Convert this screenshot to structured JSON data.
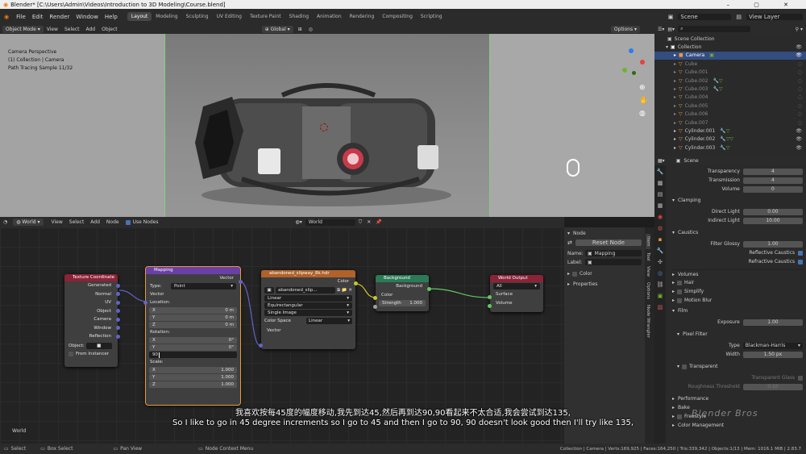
{
  "window": {
    "title": "Blender* [C:\\Users\\Admin\\Videos\\Introduction to 3D Modeling\\Course.blend]"
  },
  "menu": [
    "File",
    "Edit",
    "Render",
    "Window",
    "Help"
  ],
  "workspaces": [
    "Layout",
    "Modeling",
    "Sculpting",
    "UV Editing",
    "Texture Paint",
    "Shading",
    "Animation",
    "Rendering",
    "Compositing",
    "Scripting"
  ],
  "scene_name": "Scene",
  "view_layer": "View Layer",
  "viewport": {
    "mode": "Object Mode",
    "menus": [
      "View",
      "Select",
      "Add",
      "Object"
    ],
    "transform": "Global",
    "options": "Options",
    "overlay_text": [
      "Camera Perspective",
      "(1) Collection | Camera",
      "Path Tracing Sample 11/32"
    ]
  },
  "node_editor": {
    "type": "World",
    "menus": [
      "View",
      "Select",
      "Add",
      "Node"
    ],
    "use_nodes": "Use Nodes",
    "world_name": "World",
    "corner_label": "World",
    "nodes": {
      "tex_coord": {
        "title": "Texture Coordinate",
        "outputs": [
          "Generated",
          "Normal",
          "UV",
          "Object",
          "Camera",
          "Window",
          "Reflection"
        ],
        "object_label": "Object:",
        "from_instancer": "From Instancer"
      },
      "mapping": {
        "title": "Mapping",
        "out": "Vector",
        "type_label": "Type:",
        "type_value": "Point",
        "vector": "Vector",
        "location": "Location:",
        "loc": [
          {
            "k": "X",
            "v": "0 m"
          },
          {
            "k": "Y",
            "v": "0 m"
          },
          {
            "k": "Z",
            "v": "0 m"
          }
        ],
        "rotation": "Rotation:",
        "rot": [
          {
            "k": "X",
            "v": "0°"
          },
          {
            "k": "Y",
            "v": "0°"
          },
          {
            "k": "",
            "v": ""
          }
        ],
        "rot_edit": "90",
        "scale": "Scale:",
        "scl": [
          {
            "k": "X",
            "v": "1.000"
          },
          {
            "k": "Y",
            "v": "1.000"
          },
          {
            "k": "Z",
            "v": "1.000"
          }
        ]
      },
      "env": {
        "title": "abandoned_slipway_8k.hdr",
        "color": "Color",
        "file": "abandoned_slip...",
        "interp": "Linear",
        "proj": "Equirectangular",
        "source": "Single Image",
        "cs_label": "Color Space",
        "cs_value": "Linear",
        "vector": "Vector"
      },
      "background": {
        "title": "Background",
        "out": "Background",
        "color": "Color",
        "strength": "Strength",
        "strength_value": "1.000"
      },
      "world_output": {
        "title": "World Output",
        "target": "All",
        "surface": "Surface",
        "volume": "Volume"
      }
    }
  },
  "node_sidebar": {
    "section": "Node",
    "reset": "Reset Node",
    "name_label": "Name:",
    "name_value": "Mapping",
    "label_label": "Label:",
    "color": "Color",
    "properties": "Properties",
    "tabs": [
      "Item",
      "Tool",
      "View",
      "Options",
      "Node Wrangler"
    ]
  },
  "outliner": {
    "rows": [
      {
        "name": "Scene Collection",
        "indent": 0
      },
      {
        "name": "Collection",
        "indent": 1
      },
      {
        "name": "Camera",
        "indent": 2
      },
      {
        "name": "Cube",
        "indent": 2
      },
      {
        "name": "Cube.001",
        "indent": 2
      },
      {
        "name": "Cube.002",
        "indent": 2
      },
      {
        "name": "Cube.003",
        "indent": 2
      },
      {
        "name": "Cube.004",
        "indent": 2
      },
      {
        "name": "Cube.005",
        "indent": 2
      },
      {
        "name": "Cube.006",
        "indent": 2
      },
      {
        "name": "Cube.007",
        "indent": 2
      },
      {
        "name": "Cylinder.001",
        "indent": 2
      },
      {
        "name": "Cylinder.002",
        "indent": 2
      },
      {
        "name": "Cylinder.003",
        "indent": 2
      }
    ],
    "selected": "Camera"
  },
  "properties": {
    "context": "Scene",
    "rows": [
      {
        "label": "Transparency",
        "value": "4"
      },
      {
        "label": "Transmission",
        "value": "4"
      },
      {
        "label": "Volume",
        "value": "0"
      }
    ],
    "clamping": "Clamping",
    "direct_light": {
      "label": "Direct Light",
      "value": "0.00"
    },
    "indirect_light": {
      "label": "Indirect Light",
      "value": "10.00"
    },
    "caustics": "Caustics",
    "filter_glossy": {
      "label": "Filter Glossy",
      "value": "1.00"
    },
    "reflective_caustics": "Reflective Caustics",
    "refractive_caustics": "Refractive Caustics",
    "volumes": "Volumes",
    "hair": "Hair",
    "simplify": "Simplify",
    "motion_blur": "Motion Blur",
    "film": "Film",
    "exposure": {
      "label": "Exposure",
      "value": "1.00"
    },
    "pixel_filter": "Pixel Filter",
    "filter_type": {
      "label": "Type",
      "value": "Blackman-Harris"
    },
    "width": {
      "label": "Width",
      "value": "1.50 px"
    },
    "transparent": "Transparent",
    "transparent_glass": "Transparent Glass",
    "roughness_threshold": {
      "label": "Roughness Threshold",
      "value": "0.10"
    },
    "performance": "Performance",
    "bake": "Bake",
    "freestyle": "Freestyle",
    "color_management": "Color Management"
  },
  "subtitles": {
    "zh": "我喜欢按每45度的幅度移动,我先到达45,然后再到达90,90看起来不太合适,我会尝试到达135,",
    "en": "So I like to go in 45 degree increments so I go to 45 and then I go to 90, 90 doesn't look good then I'll try like 135,"
  },
  "watermark": "Blender Bros",
  "statusbar": {
    "left": [
      "Select",
      "Box Select",
      "Pan View",
      "Node Context Menu"
    ],
    "right": "Collection | Camera | Verts:169,925 | Faces:164,250 | Tris:339,342 | Objects:1/13 | Mem: 1016.1 MiB | 2.83.7"
  }
}
